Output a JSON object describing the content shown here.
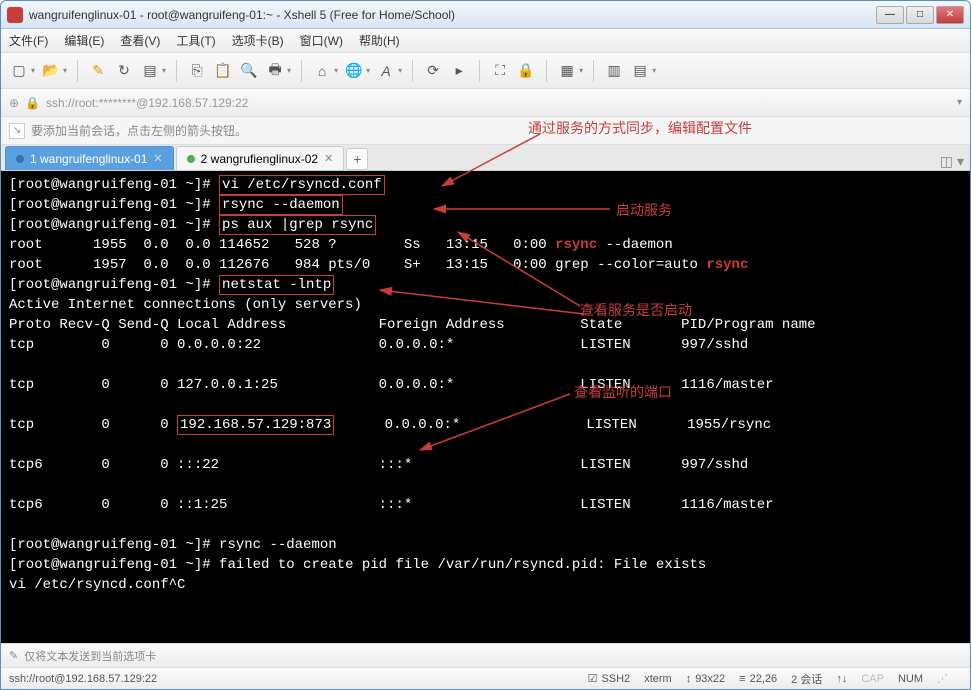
{
  "window": {
    "title": "wangruifenglinux-01 - root@wangruifeng-01:~ - Xshell 5 (Free for Home/School)"
  },
  "menu": {
    "file": "文件(F)",
    "edit": "编辑(E)",
    "view": "查看(V)",
    "tools": "工具(T)",
    "tabs": "选项卡(B)",
    "window": "窗口(W)",
    "help": "帮助(H)"
  },
  "addressbar": {
    "value": "ssh://root:********@192.168.57.129:22"
  },
  "infobar": {
    "text": "要添加当前会话，点击左侧的箭头按钮。"
  },
  "tabs": [
    {
      "label": "1 wangruifenglinux-01",
      "active": true
    },
    {
      "label": "2 wangrufienglinux-02",
      "active": false
    }
  ],
  "annotations": {
    "a1": "通过服务的方式同步，编辑配置文件",
    "a2": "启动服务",
    "a3": "查看服务是否启动",
    "a4": "查看监听的端口"
  },
  "terminal": {
    "lines": [
      {
        "prompt": "[root@wangruifeng-01 ~]# ",
        "cmd": "vi /etc/rsyncd.conf",
        "box": true
      },
      {
        "prompt": "[root@wangruifeng-01 ~]# ",
        "cmd": "rsync --daemon",
        "box": true
      },
      {
        "prompt": "[root@wangruifeng-01 ~]# ",
        "cmd": "ps aux |grep rsync",
        "box": true
      },
      {
        "text": "root      1955  0.0  0.0 114652   528 ?        Ss   13:15   0:00 ",
        "red1": "rsync",
        "after": " --daemon"
      },
      {
        "text": "root      1957  0.0  0.0 112676   984 pts/0    S+   13:15   0:00 grep --color=auto ",
        "red1": "rsync"
      },
      {
        "prompt": "[root@wangruifeng-01 ~]# ",
        "cmd": "netstat -lntp",
        "box": true
      },
      {
        "text": "Active Internet connections (only servers)"
      },
      {
        "text": "Proto Recv-Q Send-Q Local Address           Foreign Address         State       PID/Program name"
      },
      {
        "text": "tcp        0      0 0.0.0.0:22              0.0.0.0:*               LISTEN      997/sshd"
      },
      {
        "text": ""
      },
      {
        "text": "tcp        0      0 127.0.0.1:25            0.0.0.0:*               LISTEN      1116/master"
      },
      {
        "text": ""
      },
      {
        "text_pre": "tcp        0      0 ",
        "boxtext": "192.168.57.129:873",
        "text_post": "      0.0.0.0:*               LISTEN      1955/rsync"
      },
      {
        "text": ""
      },
      {
        "text": "tcp6       0      0 :::22                   :::*                    LISTEN      997/sshd"
      },
      {
        "text": ""
      },
      {
        "text": "tcp6       0      0 ::1:25                  :::*                    LISTEN      1116/master"
      },
      {
        "text": ""
      },
      {
        "prompt": "[root@wangruifeng-01 ~]# ",
        "cmd": "rsync --daemon"
      },
      {
        "prompt": "[root@wangruifeng-01 ~]# ",
        "cmd": "failed to create pid file /var/run/rsyncd.pid: File exists"
      },
      {
        "text": "vi /etc/rsyncd.conf^C"
      }
    ]
  },
  "footbar": {
    "text": "仅将文本发送到当前选项卡"
  },
  "statusbar": {
    "conn": "ssh://root@192.168.57.129:22",
    "proto": "SSH2",
    "term": "xterm",
    "size": "93x22",
    "pos": "22,26",
    "sessions": "2 会话",
    "cap": "CAP",
    "num": "NUM"
  }
}
